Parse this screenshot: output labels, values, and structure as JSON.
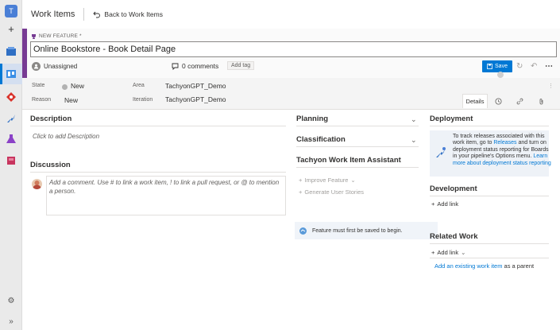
{
  "rail": {
    "org_initial": "T",
    "items": [
      "add-icon",
      "boards-icon",
      "work-items-icon",
      "repos-icon",
      "pipelines-icon",
      "test-plans-icon",
      "artifacts-icon"
    ],
    "settings_icon": "gear-icon",
    "collapse_icon": "double-chevron-icon"
  },
  "topbar": {
    "app_title": "Work Items",
    "back_label": "Back to Work Items"
  },
  "work_item": {
    "type_label": "NEW FEATURE *",
    "title": "Online Bookstore - Book Detail Page",
    "assignee": "Unassigned",
    "comments": "0 comments",
    "add_tag": "Add tag",
    "save_label": "Save"
  },
  "fields": {
    "state_label": "State",
    "state_value": "New",
    "reason_label": "Reason",
    "reason_value": "New",
    "area_label": "Area",
    "area_value": "TachyonGPT_Demo",
    "iteration_label": "Iteration",
    "iteration_value": "TachyonGPT_Demo"
  },
  "tabs": {
    "details": "Details"
  },
  "left": {
    "description_title": "Description",
    "description_placeholder": "Click to add Description",
    "discussion_title": "Discussion",
    "discussion_placeholder": "Add a comment. Use # to link a work item, ! to link a pull request, or @ to mention a person."
  },
  "middle": {
    "planning_title": "Planning",
    "classification_title": "Classification",
    "assistant_title": "Tachyon Work Item Assistant",
    "improve_feature": "Improve Feature",
    "generate_stories": "Generate User Stories",
    "notice": "Feature must first be saved to begin."
  },
  "right": {
    "deployment_title": "Deployment",
    "deployment_text_1": "To track releases associated with this work item, go to ",
    "deployment_releases": "Releases",
    "deployment_text_2": " and turn on deployment status reporting for Boards in your pipeline's Options menu. ",
    "deployment_learn_more": "Learn more about deployment status reporting",
    "development_title": "Development",
    "development_add_link": "Add link",
    "related_title": "Related Work",
    "related_add_link": "Add link",
    "existing_item": "Add an existing work item",
    "as_parent": " as a parent"
  },
  "colors": {
    "accent": "#0078d4",
    "feature": "#773b93"
  }
}
